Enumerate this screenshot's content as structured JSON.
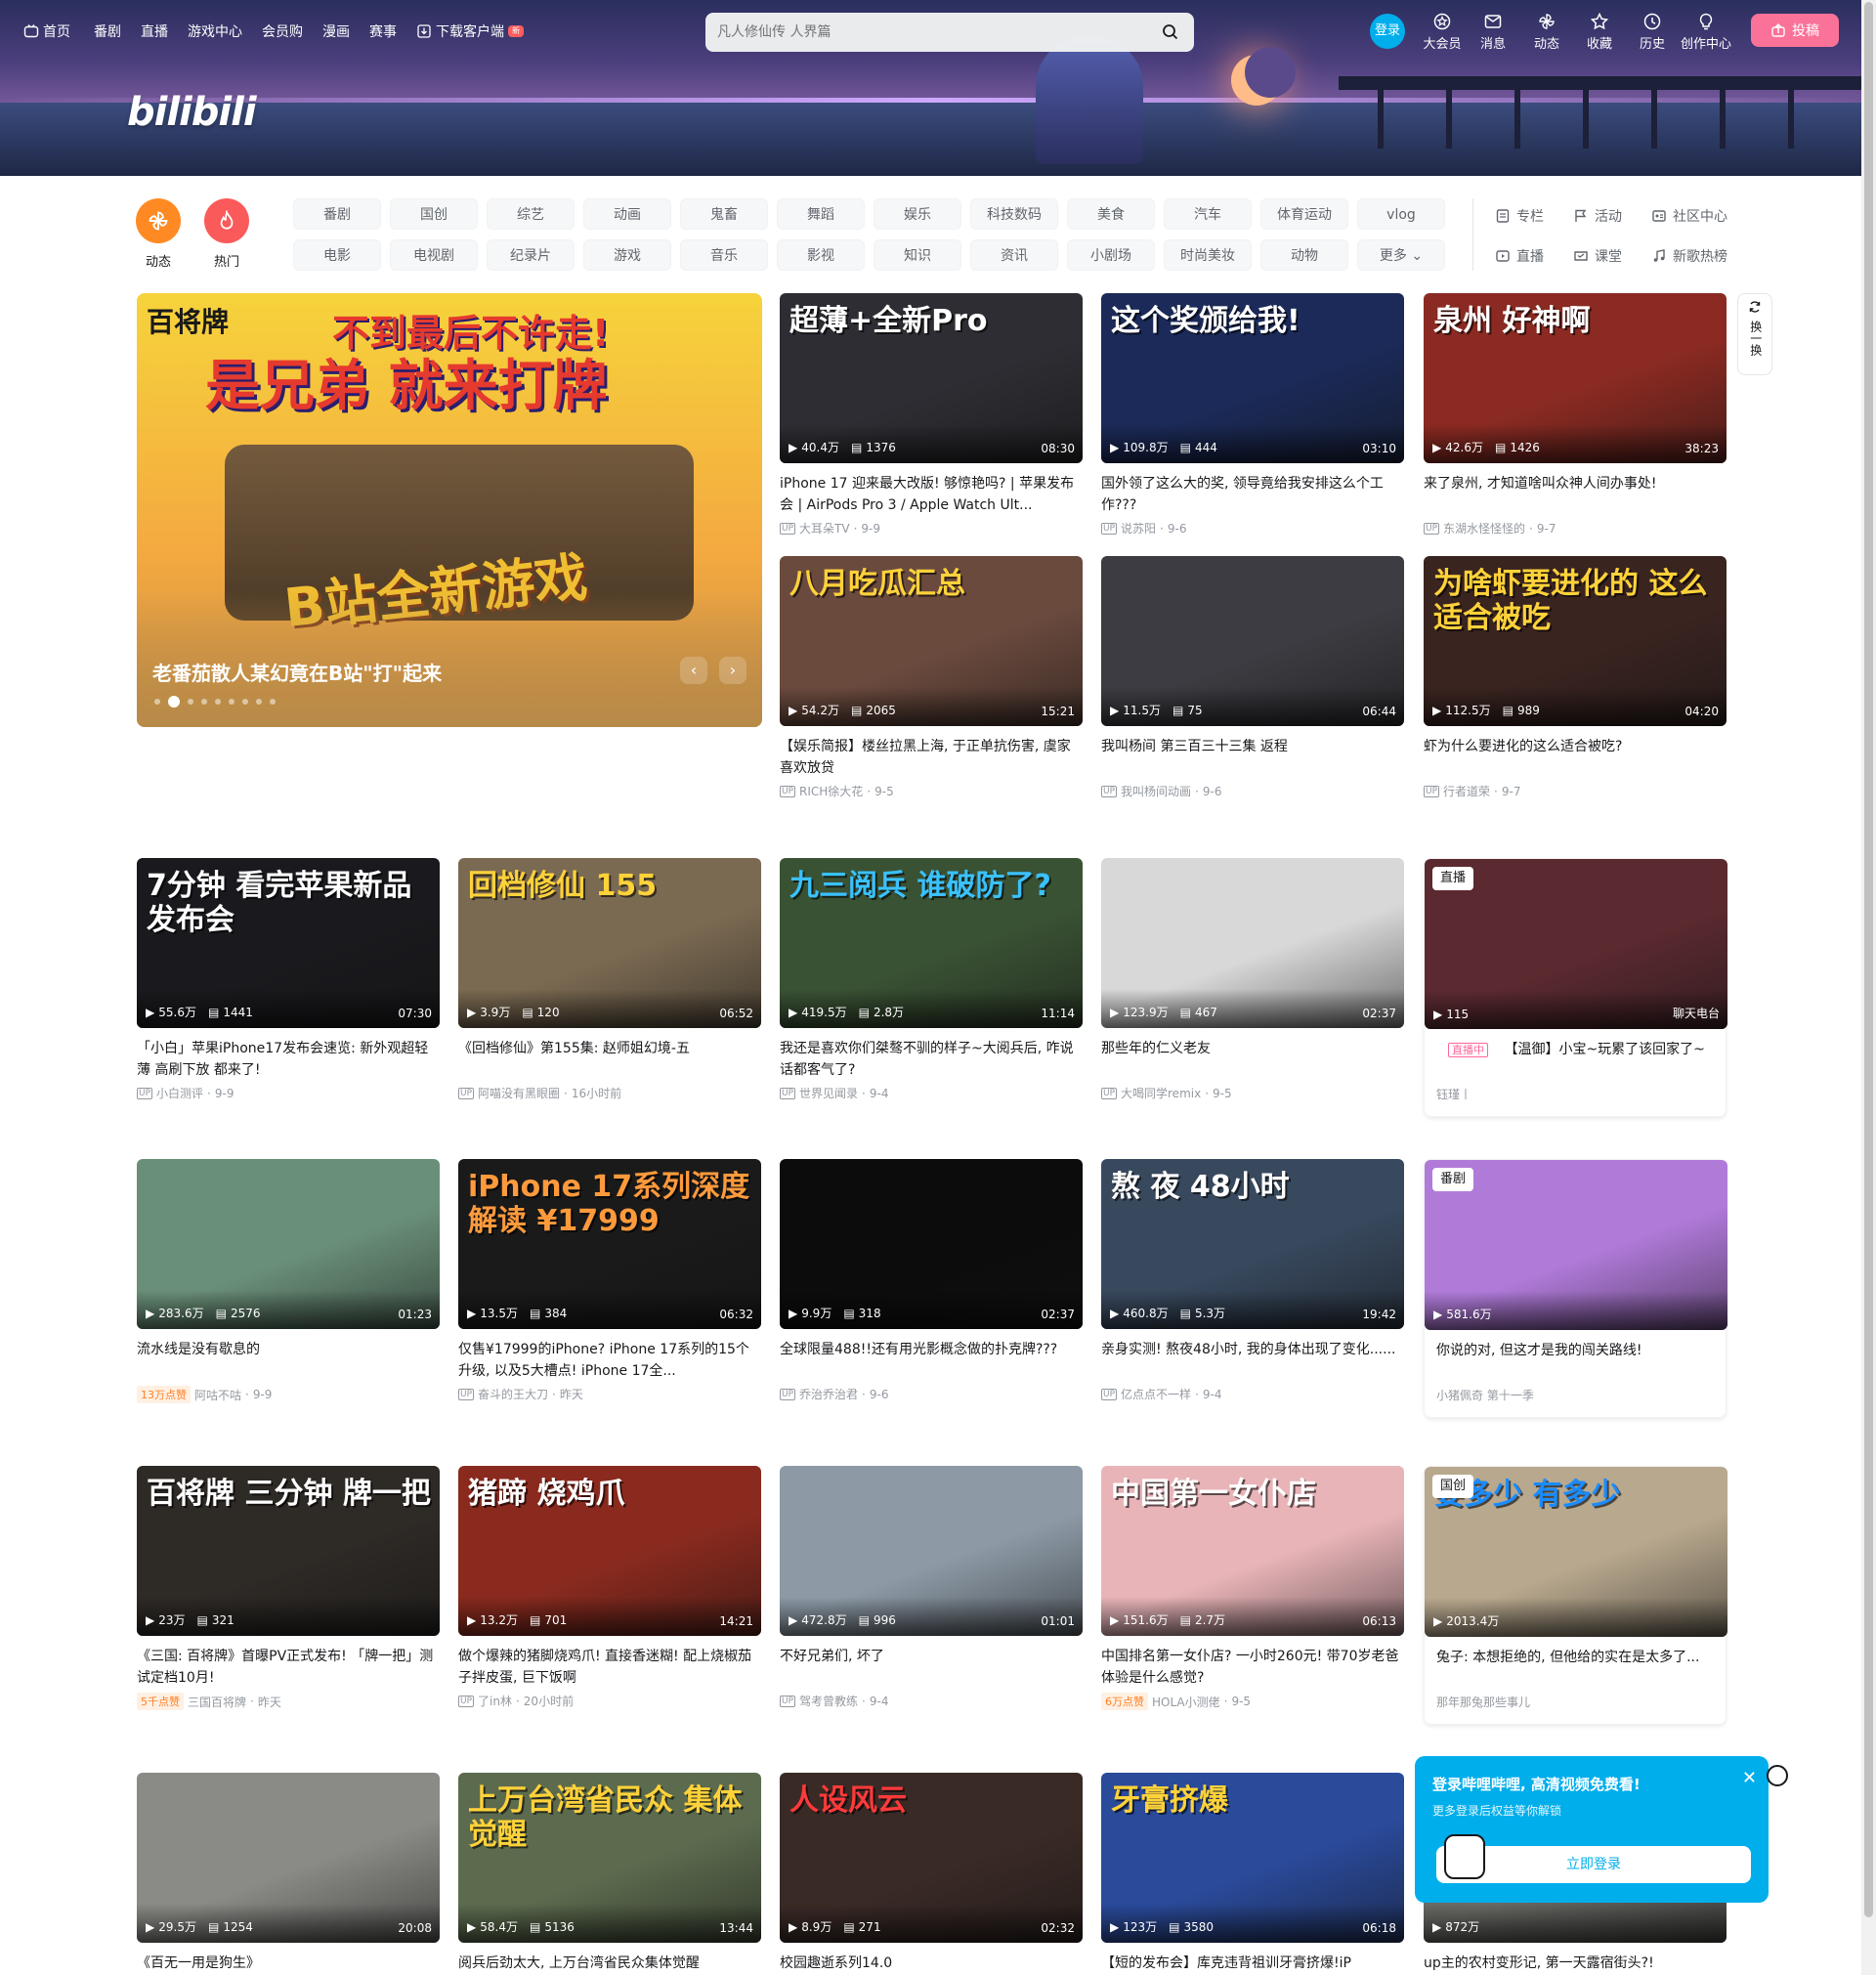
{
  "nav": {
    "left": [
      "首页",
      "番剧",
      "直播",
      "游戏中心",
      "会员购",
      "漫画",
      "赛事",
      "下载客户端"
    ],
    "new_badge": "新",
    "search_placeholder": "凡人修仙传 人界篇",
    "login": "登录",
    "right": [
      "大会员",
      "消息",
      "动态",
      "收藏",
      "历史",
      "创作中心"
    ],
    "upload": "投稿",
    "logo": "bilibili"
  },
  "channels": [
    {
      "label": "动态",
      "color": "#ff8a24",
      "icon": "pinwheel-icon"
    },
    {
      "label": "热门",
      "color": "#fb5a5a",
      "icon": "flame-icon"
    }
  ],
  "categories_row1": [
    "番剧",
    "国创",
    "综艺",
    "动画",
    "鬼畜",
    "舞蹈",
    "娱乐",
    "科技数码",
    "美食",
    "汽车",
    "体育运动",
    "vlog"
  ],
  "categories_row2": [
    "电影",
    "电视剧",
    "纪录片",
    "游戏",
    "音乐",
    "影视",
    "知识",
    "资讯",
    "小剧场",
    "时尚美妆",
    "动物",
    "更多"
  ],
  "right_links": [
    "专栏",
    "活动",
    "社区中心",
    "直播",
    "课堂",
    "新歌热榜"
  ],
  "featured": {
    "title": "老番茄散人某幻竟在B站\"打\"起来",
    "headline": "是兄弟 就来打牌",
    "subline": "不到最后不许走!",
    "brand": "百将牌",
    "game_line": "B站全新游戏"
  },
  "refresh": "换一换",
  "cards": [
    {
      "title": "iPhone 17 迎来最大改版! 够惊艳吗? | 苹果发布会 | AirPods Pro 3 / Apple Watch Ult...",
      "up": "大耳朵TV",
      "date": "9-9",
      "views": "40.4万",
      "danmaku": "1376",
      "dur": "08:30",
      "thumb_text": "超薄+全新Pro",
      "bg": "#2d2d33",
      "fg": "#ffffff"
    },
    {
      "title": "国外领了这么大的奖, 领导竟给我安排这么个工作???",
      "up": "说苏阳",
      "date": "9-6",
      "views": "109.8万",
      "danmaku": "444",
      "dur": "03:10",
      "thumb_text": "这个奖颁给我!",
      "bg": "#1b2a58",
      "fg": "#ffffff"
    },
    {
      "title": "来了泉州, 才知道啥叫众神人间办事处!",
      "up": "东湖水怪怪怪的",
      "date": "9-7",
      "views": "42.6万",
      "danmaku": "1426",
      "dur": "38:23",
      "thumb_text": "泉州 好神啊",
      "bg": "#8a2a22",
      "fg": "#ffffff"
    },
    {
      "title": "【娱乐简报】楼丝拉黑上海, 于正单抗伤害, 虞家喜欢放贷",
      "up": "RICH徐大花",
      "date": "9-5",
      "views": "54.2万",
      "danmaku": "2065",
      "dur": "15:21",
      "thumb_text": "八月吃瓜汇总",
      "bg": "#6b4a3e",
      "fg": "#ffd23a"
    },
    {
      "title": "我叫杨间 第三百三十三集 返程",
      "up": "我叫杨间动画",
      "date": "9-6",
      "views": "11.5万",
      "danmaku": "75",
      "dur": "06:44",
      "thumb_text": "",
      "bg": "#3c3c42",
      "fg": "#ffffff"
    },
    {
      "title": "虾为什么要进化的这么适合被吃?",
      "up": "行者道荣",
      "date": "9-7",
      "views": "112.5万",
      "danmaku": "989",
      "dur": "04:20",
      "thumb_text": "为啥虾要进化的 这么适合被吃",
      "bg": "#3a2420",
      "fg": "#ffd23a"
    },
    {
      "title": "「小白」苹果iPhone17发布会速览: 新外观超轻薄 高刷下放 都来了!",
      "up": "小白测评",
      "date": "9-9",
      "views": "55.6万",
      "danmaku": "1441",
      "dur": "07:30",
      "thumb_text": "7分钟 看完苹果新品 发布会",
      "bg": "#1a1a1e",
      "fg": "#ffffff"
    },
    {
      "title": "《回档修仙》第155集: 赵师姐幻境-五",
      "up": "阿喵没有黑眼圈",
      "date": "16小时前",
      "views": "3.9万",
      "danmaku": "120",
      "dur": "06:52",
      "thumb_text": "回档修仙 155",
      "bg": "#7b6a52",
      "fg": "#ffd23a"
    },
    {
      "title": "我还是喜欢你们桀骜不驯的样子~大阅兵后, 咋说话都客气了?",
      "up": "世界见闻录",
      "date": "9-4",
      "views": "419.5万",
      "danmaku": "2.8万",
      "dur": "11:14",
      "thumb_text": "九三阅兵 谁破防了?",
      "bg": "#3a5234",
      "fg": "#3ac1ff"
    },
    {
      "title": "那些年的仁义老友",
      "up": "大喝同学remix",
      "date": "9-5",
      "views": "123.9万",
      "danmaku": "467",
      "dur": "02:37",
      "thumb_text": "",
      "bg": "#d8d8d8",
      "fg": "#ffffff"
    },
    {
      "title": "【温御】小宝~玩累了该回家了~",
      "up": "钰瑾丨",
      "date": "",
      "views": "115",
      "danmaku": "",
      "dur": "聊天电台",
      "thumb_text": "",
      "bg": "#5b2a30",
      "fg": "#ffffff",
      "badge": "直播",
      "live_tag": "直播中"
    },
    {
      "title": "流水线是没有歇息的",
      "up": "阿咕不咕",
      "date": "9-9",
      "views": "283.6万",
      "danmaku": "2576",
      "dur": "01:23",
      "thumb_text": "",
      "bg": "#6a8f78",
      "fg": "#ffffff",
      "tag": "13万点赞"
    },
    {
      "title": "仅售¥17999的iPhone? iPhone 17系列的15个升级, 以及5大槽点! iPhone 17全...",
      "up": "奋斗的王大刀",
      "date": "昨天",
      "views": "13.5万",
      "danmaku": "384",
      "dur": "06:32",
      "thumb_text": "iPhone 17系列深度解读 ¥17999",
      "bg": "#1a1a1a",
      "fg": "#ff9a3c"
    },
    {
      "title": "全球限量488!!还有用光影概念做的扑克牌???",
      "up": "乔治乔治君",
      "date": "9-6",
      "views": "9.9万",
      "danmaku": "318",
      "dur": "02:37",
      "thumb_text": "",
      "bg": "#0c0c0c",
      "fg": "#ffffff"
    },
    {
      "title": "亲身实测! 熬夜48小时, 我的身体出现了变化......",
      "up": "亿点点不一样",
      "date": "9-4",
      "views": "460.8万",
      "danmaku": "5.3万",
      "dur": "19:42",
      "thumb_text": "熬 夜 48小时",
      "bg": "#38495e",
      "fg": "#ffffff"
    },
    {
      "title": "你说的对, 但这才是我的闯关路线!",
      "up": "小猪佩奇 第十一季",
      "date": "",
      "views": "581.6万",
      "danmaku": "",
      "dur": "",
      "thumb_text": "",
      "bg": "#b07ad9",
      "fg": "#ffffff",
      "badge": "番剧"
    },
    {
      "title": "《三国: 百将牌》首曝PV正式发布! 「牌一把」测试定档10月!",
      "up": "三国百将牌",
      "date": "昨天",
      "views": "23万",
      "danmaku": "321",
      "dur": "",
      "thumb_text": "百将牌 三分钟 牌一把",
      "bg": "#2e2a26",
      "fg": "#ffffff",
      "tag": "5千点赞"
    },
    {
      "title": "做个爆辣的猪脚烧鸡爪! 直接香迷糊! 配上烧椒茄子拌皮蛋, 巨下饭啊",
      "up": "了in林",
      "date": "20小时前",
      "views": "13.2万",
      "danmaku": "701",
      "dur": "14:21",
      "thumb_text": "猪蹄 烧鸡爪",
      "bg": "#8a2a1e",
      "fg": "#ffffff"
    },
    {
      "title": "不好兄弟们, 坏了",
      "up": "驾考曾教练",
      "date": "9-4",
      "views": "472.8万",
      "danmaku": "996",
      "dur": "01:01",
      "thumb_text": "",
      "bg": "#8d9aa6",
      "fg": "#ffffff"
    },
    {
      "title": "中国排名第一女仆店? 一小时260元! 带70岁老爸体验是什么感觉?",
      "up": "HOLA小测佬",
      "date": "9-5",
      "views": "151.6万",
      "danmaku": "2.7万",
      "dur": "06:13",
      "thumb_text": "中国第一女仆店",
      "bg": "#e8b4b8",
      "fg": "#ffffff",
      "tag": "6万点赞"
    },
    {
      "title": "兔子: 本想拒绝的, 但他给的实在是太多了...",
      "up": "那年那兔那些事儿",
      "date": "",
      "views": "2013.4万",
      "danmaku": "",
      "dur": "",
      "thumb_text": "要多少 有多少",
      "bg": "#b8a88e",
      "fg": "#1a8cff",
      "badge": "国创"
    },
    {
      "title": "《百无一用是狗生》",
      "up": "",
      "date": "",
      "views": "29.5万",
      "danmaku": "1254",
      "dur": "20:08",
      "thumb_text": "",
      "bg": "#8a8a86",
      "fg": "#ffffff"
    },
    {
      "title": "阅兵后劲太大, 上万台湾省民众集体觉醒",
      "up": "",
      "date": "",
      "views": "58.4万",
      "danmaku": "5136",
      "dur": "13:44",
      "thumb_text": "上万台湾省民众 集体觉醒",
      "bg": "#5c6b4e",
      "fg": "#ffd23a"
    },
    {
      "title": "校园趣逝系列14.0",
      "up": "",
      "date": "",
      "views": "8.9万",
      "danmaku": "271",
      "dur": "02:32",
      "thumb_text": "人设风云",
      "bg": "#3a2a26",
      "fg": "#ff3a3a"
    },
    {
      "title": "【短的发布会】库克违背祖训牙膏挤爆!iP",
      "up": "",
      "date": "",
      "views": "123万",
      "danmaku": "3580",
      "dur": "06:18",
      "thumb_text": "牙膏挤爆",
      "bg": "#2a4a9a",
      "fg": "#ffd23a"
    },
    {
      "title": "up主的农村变形记, 第一天露宿街头?!",
      "up": "",
      "date": "",
      "views": "872万",
      "danmaku": "",
      "dur": "",
      "thumb_text": "",
      "bg": "#6a6a66",
      "fg": "#ffffff"
    }
  ],
  "popup": {
    "title": "登录哔哩哔哩, 高清视频免费看!",
    "sub": "更多登录后权益等你解锁",
    "button": "立即登录"
  }
}
